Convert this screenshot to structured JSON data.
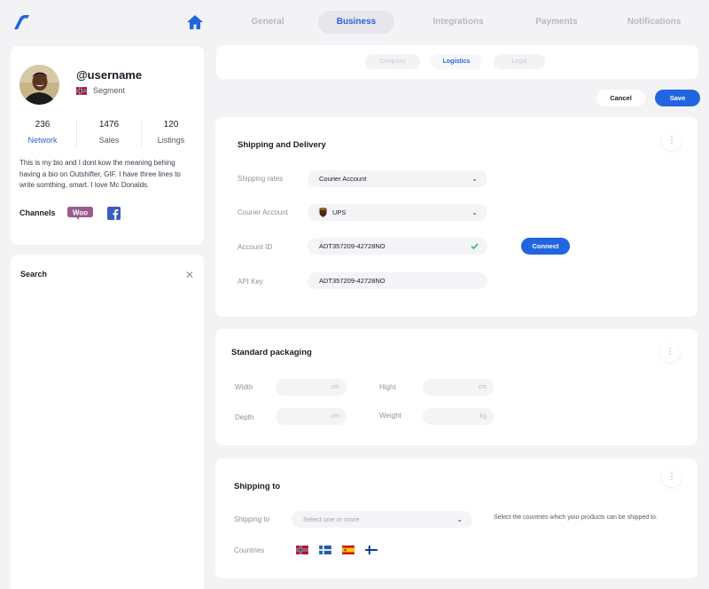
{
  "nav": {
    "tabs": [
      {
        "label": "General"
      },
      {
        "label": "Business",
        "active": true
      },
      {
        "label": "Integrations"
      },
      {
        "label": "Payments"
      },
      {
        "label": "Notifications"
      }
    ]
  },
  "profile": {
    "username": "@username",
    "segment": "Segment",
    "stats": [
      {
        "value": "236",
        "label": "Network"
      },
      {
        "value": "1476",
        "label": "Sales"
      },
      {
        "value": "120",
        "label": "Listings"
      }
    ],
    "bio": "This is my bio and I dont kow the meaning behing having a bio on Outshifter, GIF. I have three lines to write somthing, smart. I love Mc Donalds.",
    "channels_label": "Channels",
    "woo_label": "Woo"
  },
  "search": {
    "title": "Search",
    "close_glyph": "✕"
  },
  "subtabs": [
    {
      "label": "Company"
    },
    {
      "label": "Logistics",
      "active": true
    },
    {
      "label": "Legal"
    }
  ],
  "actions": {
    "cancel": "Cancel",
    "save": "Save"
  },
  "shipping": {
    "title": "Shipping and Delivery",
    "rates_label": "Shipping rates",
    "rates_value": "Courier Account",
    "courier_label": "Courier Account",
    "courier_value": "UPS",
    "account_id_label": "Account ID",
    "account_id_value": "ADT357209-42728NO",
    "api_key_label": "API Key",
    "api_key_value": "ADT357209-42728NO",
    "connect": "Connect"
  },
  "packaging": {
    "title": "Standard packaging",
    "width_label": "Width",
    "hight_label": "Hight",
    "depth_label": "Depth",
    "weight_label": "Weight",
    "unit_cm": "cm",
    "unit_kg": "kg"
  },
  "shipping_to": {
    "title": "Shipping to",
    "shipping_to_label": "Shipping to",
    "select_placeholder": "Select one or more",
    "hint": "Select the countries which your products can be shipped to.",
    "countries_label": "Countries",
    "flags": [
      "norway-flag",
      "finland-flag",
      "spain-flag",
      "finland-flag"
    ]
  },
  "kebab_glyph": "⋮",
  "chevron_glyph": "⌄",
  "colors": {
    "accent": "#2166e0",
    "background": "#f3f3f6",
    "check": "#2bb673"
  }
}
